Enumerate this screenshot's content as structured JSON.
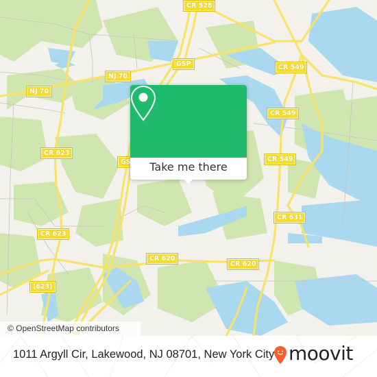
{
  "map": {
    "road_labels": [
      {
        "id": "cr528",
        "text": "CR 528"
      },
      {
        "id": "gsp-top",
        "text": "GSP"
      },
      {
        "id": "nj70-right",
        "text": "NJ 70"
      },
      {
        "id": "nj70-left",
        "text": "NJ 70"
      },
      {
        "id": "cr549-top",
        "text": "CR 549"
      },
      {
        "id": "cr549-mid",
        "text": "CR 549"
      },
      {
        "id": "cr549-low",
        "text": "CR 549"
      },
      {
        "id": "cr623-top",
        "text": "CR 623"
      },
      {
        "id": "gsp-mid",
        "text": "GSP"
      },
      {
        "id": "cr623-low",
        "text": "CR 623"
      },
      {
        "id": "cr631",
        "text": "CR 631"
      },
      {
        "id": "cr620-left",
        "text": "CR 620"
      },
      {
        "id": "cr620-right",
        "text": "CR 620"
      },
      {
        "id": "cr623-paren",
        "text": "(623)"
      }
    ],
    "attribution": "© OpenStreetMap contributors",
    "colors": {
      "land": "#f2f1ec",
      "park": "#cfe6b0",
      "water": "#a9d8ef",
      "road": "#f7e36a",
      "label_bg": "#f5dc2e"
    }
  },
  "popup": {
    "action_label": "Take me there",
    "icon": "map-pin-icon",
    "accent_color": "#1fba6b"
  },
  "footer": {
    "address": "1011 Argyll Cir, Lakewood, NJ 08701, New York City",
    "brand": "moovit",
    "brand_icon": "moovit-pin-smile-icon",
    "brand_color": "#f2612a"
  }
}
